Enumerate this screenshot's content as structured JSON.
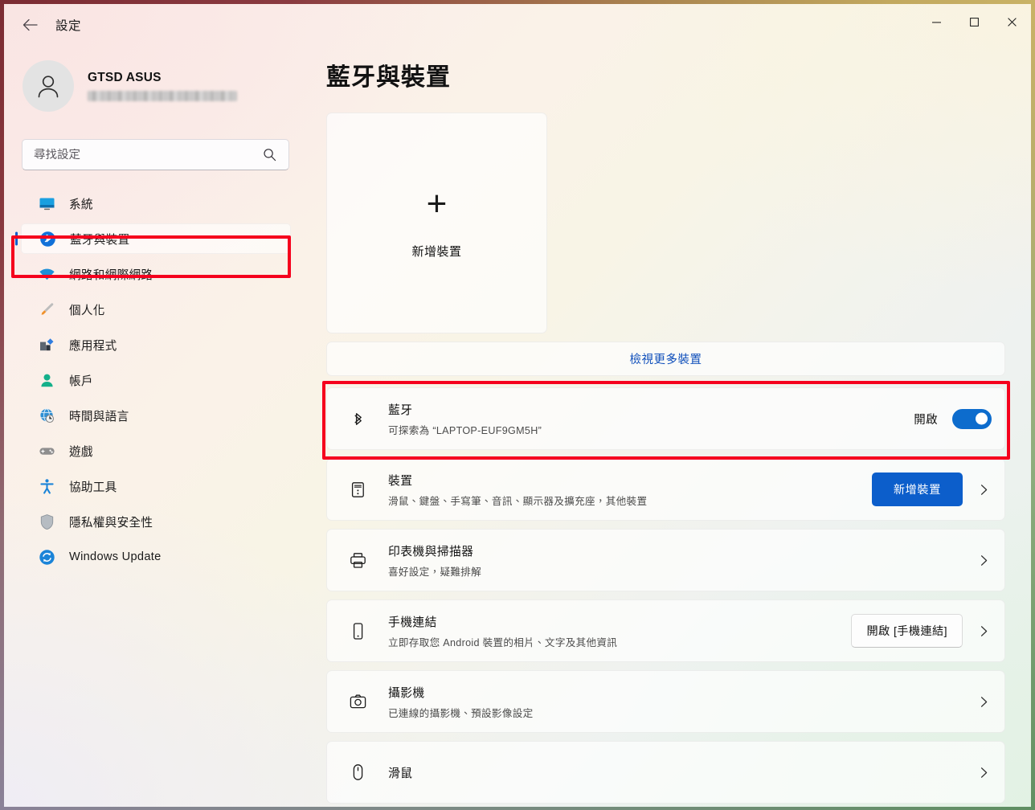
{
  "titlebar": {
    "back_icon": "back-arrow-icon",
    "title": "設定",
    "minimize": "─",
    "maximize": "□",
    "close": "✕"
  },
  "sidebar": {
    "profile": {
      "name": "GTSD ASUS",
      "email_redacted": true,
      "avatar_icon": "person-icon"
    },
    "search": {
      "placeholder": "尋找設定",
      "value": "",
      "icon": "search-icon"
    },
    "items": [
      {
        "label": "系統",
        "icon": "monitor-icon",
        "active": false
      },
      {
        "label": "藍牙與裝置",
        "icon": "bluetooth-icon",
        "active": true
      },
      {
        "label": "網路和網際網路",
        "icon": "wifi-icon",
        "active": false
      },
      {
        "label": "個人化",
        "icon": "paintbrush-icon",
        "active": false
      },
      {
        "label": "應用程式",
        "icon": "apps-icon",
        "active": false
      },
      {
        "label": "帳戶",
        "icon": "account-icon",
        "active": false
      },
      {
        "label": "時間與語言",
        "icon": "clock-globe-icon",
        "active": false
      },
      {
        "label": "遊戲",
        "icon": "gamepad-icon",
        "active": false
      },
      {
        "label": "協助工具",
        "icon": "accessibility-icon",
        "active": false
      },
      {
        "label": "隱私權與安全性",
        "icon": "shield-icon",
        "active": false
      },
      {
        "label": "Windows Update",
        "icon": "update-refresh-icon",
        "active": false
      }
    ]
  },
  "main": {
    "page_title": "藍牙與裝置",
    "add_device_card": {
      "plus": "+",
      "label": "新增裝置",
      "icon": "plus-icon"
    },
    "view_more": {
      "label": "檢視更多裝置"
    },
    "rows": [
      {
        "key": "bluetooth",
        "icon": "bluetooth-icon",
        "title": "藍牙",
        "subtitle": "可探索為 “LAPTOP-EUF9GM5H”",
        "toggle_label": "開啟",
        "toggle_on": true,
        "highlighted": true,
        "has_chevron": false
      },
      {
        "key": "devices",
        "icon": "device-hub-icon",
        "title": "裝置",
        "subtitle": "滑鼠、鍵盤、手寫筆、音訊、顯示器及擴充座，其他裝置",
        "button_label": "新增裝置",
        "button_style": "primary",
        "has_chevron": true
      },
      {
        "key": "printers",
        "icon": "printer-icon",
        "title": "印表機與掃描器",
        "subtitle": "喜好設定，疑難排解",
        "has_chevron": true
      },
      {
        "key": "phone-link",
        "icon": "phone-icon",
        "title": "手機連結",
        "subtitle": "立即存取您 Android 裝置的相片、文字及其他資訊",
        "button_label": "開啟 [手機連結]",
        "button_style": "secondary",
        "has_chevron": true
      },
      {
        "key": "camera",
        "icon": "camera-icon",
        "title": "攝影機",
        "subtitle": "已連線的攝影機、預設影像設定",
        "has_chevron": true
      },
      {
        "key": "mouse",
        "icon": "mouse-icon",
        "title": "滑鼠",
        "subtitle": "",
        "has_chevron": true
      }
    ]
  },
  "annotations": {
    "sidebar_highlight": "藍牙與裝置",
    "bluetooth_row_highlight": "藍牙",
    "color": "#F5001D"
  },
  "colors": {
    "accent_blue": "#0C5ECB",
    "toggle_blue": "#0D6CCD",
    "link_blue": "#0F4FBB",
    "annotation_red": "#F5001D"
  }
}
